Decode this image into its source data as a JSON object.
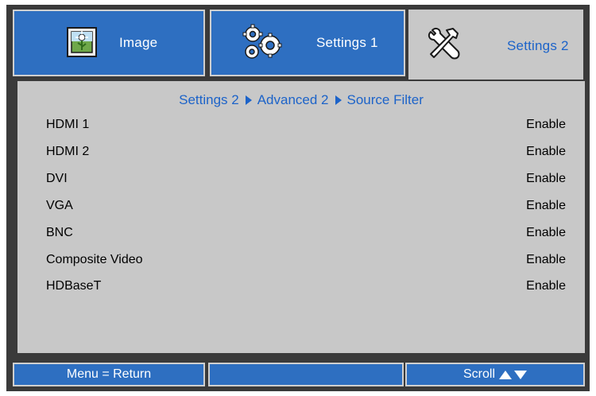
{
  "tabs": [
    {
      "label": "Image",
      "icon": "image-icon",
      "active": false
    },
    {
      "label": "Settings 1",
      "icon": "gears-icon",
      "active": false
    },
    {
      "label": "Settings 2",
      "icon": "wrench-hammer-icon",
      "active": true
    }
  ],
  "breadcrumb": {
    "items": [
      "Settings 2",
      "Advanced 2",
      "Source Filter"
    ]
  },
  "rows": [
    {
      "label": "HDMI 1",
      "value": "Enable"
    },
    {
      "label": "HDMI 2",
      "value": "Enable"
    },
    {
      "label": "DVI",
      "value": "Enable"
    },
    {
      "label": "VGA",
      "value": "Enable"
    },
    {
      "label": "BNC",
      "value": "Enable"
    },
    {
      "label": "Composite Video",
      "value": "Enable"
    },
    {
      "label": "HDBaseT",
      "value": "Enable"
    }
  ],
  "footer": {
    "left": "Menu = Return",
    "middle": "",
    "right": "Scroll"
  },
  "colors": {
    "tab_blue": "#2e6fc1",
    "accent_text": "#1c63c9",
    "panel_gray": "#c8c8c8",
    "frame_dark": "#3a3a3a"
  }
}
